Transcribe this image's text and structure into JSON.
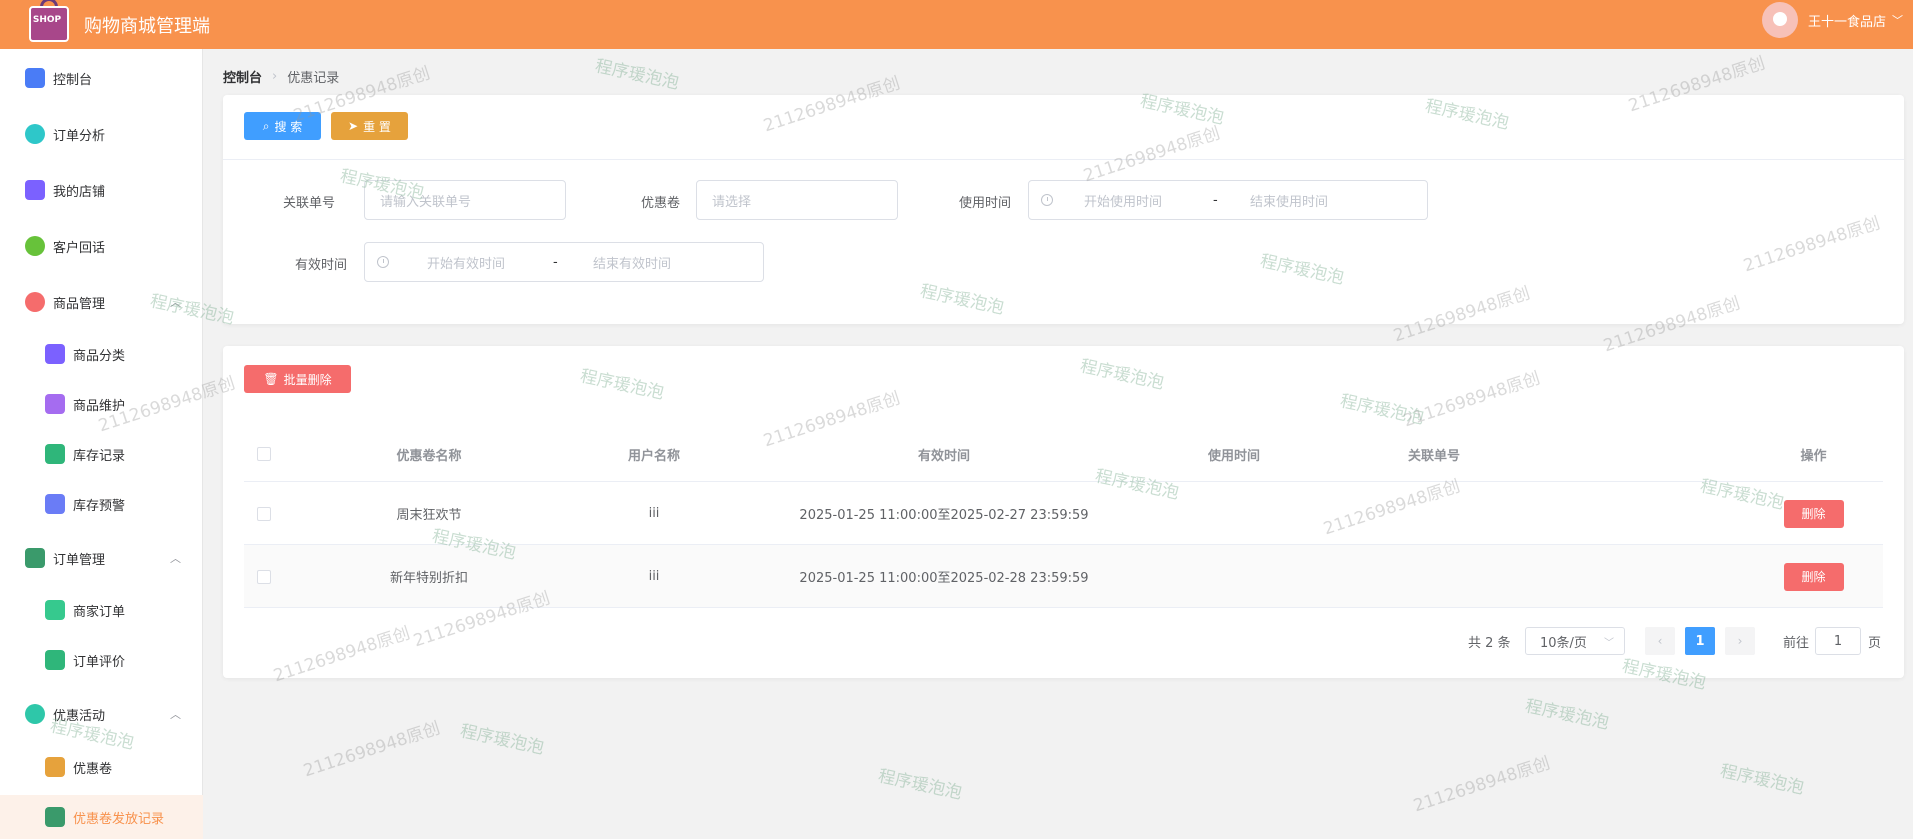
{
  "header": {
    "title": "购物商城管理端",
    "user": "王十一食品店",
    "logo_text": "SHOP"
  },
  "sidebar": [
    {
      "label": "控制台",
      "icon": "dashboard-icon",
      "color": "#4a7cf6"
    },
    {
      "label": "订单分析",
      "icon": "pie-chart-icon",
      "color": "#2ec7c9"
    },
    {
      "label": "我的店铺",
      "icon": "store-icon",
      "color": "#7b61ff"
    },
    {
      "label": "客户回话",
      "icon": "chat-icon",
      "color": "#67c23a"
    },
    {
      "label": "商品管理",
      "icon": "bag-icon",
      "color": "#f56c6c"
    },
    {
      "label": "商品分类",
      "icon": "category-icon",
      "color": "#7b61ff"
    },
    {
      "label": "商品维护",
      "icon": "briefcase-icon",
      "color": "#a56cf0"
    },
    {
      "label": "库存记录",
      "icon": "warehouse-icon",
      "color": "#2fb67a"
    },
    {
      "label": "库存预警",
      "icon": "alert-icon",
      "color": "#6a7cf6"
    },
    {
      "label": "订单管理",
      "icon": "clipboard-icon",
      "color": "#3a9a6b"
    },
    {
      "label": "商家订单",
      "icon": "bar-chart-icon",
      "color": "#36c98e"
    },
    {
      "label": "订单评价",
      "icon": "comment-icon",
      "color": "#2fb67a"
    },
    {
      "label": "优惠活动",
      "icon": "gift-icon",
      "color": "#2ec7a9"
    },
    {
      "label": "优惠卷",
      "icon": "coupon-icon",
      "color": "#e6a23c"
    },
    {
      "label": "优惠卷发放记录",
      "icon": "record-icon",
      "color": "#3a9a6b"
    }
  ],
  "breadcrumb": {
    "home": "控制台",
    "current": "优惠记录"
  },
  "search": {
    "search_label": "搜 索",
    "reset_label": "重 置",
    "order_label": "关联单号",
    "order_placeholder": "请输入关联单号",
    "coupon_label": "优惠卷",
    "coupon_placeholder": "请选择",
    "use_time_label": "使用时间",
    "use_start": "开始使用时间",
    "use_end": "结束使用时间",
    "valid_label": "有效时间",
    "valid_start": "开始有效时间",
    "valid_end": "结束有效时间",
    "range_sep": "-"
  },
  "table": {
    "bulk_delete": "批量删除",
    "columns": [
      "优惠卷名称",
      "用户名称",
      "有效时间",
      "使用时间",
      "关联单号",
      "操作"
    ],
    "rows": [
      {
        "name": "周末狂欢节",
        "user": "iii",
        "valid": "2025-01-25 11:00:00至2025-02-27 23:59:59",
        "used": "",
        "order": "",
        "action": "删除"
      },
      {
        "name": "新年特别折扣",
        "user": "iii",
        "valid": "2025-01-25 11:00:00至2025-02-28 23:59:59",
        "used": "",
        "order": "",
        "action": "删除"
      }
    ]
  },
  "pagination": {
    "total": "共 2 条",
    "page_size": "10条/页",
    "current": "1",
    "goto_prefix": "前往",
    "goto_value": "1",
    "goto_suffix": "页"
  },
  "watermarks": {
    "a": "2112698948原创",
    "b": "程序瑗泡泡"
  }
}
